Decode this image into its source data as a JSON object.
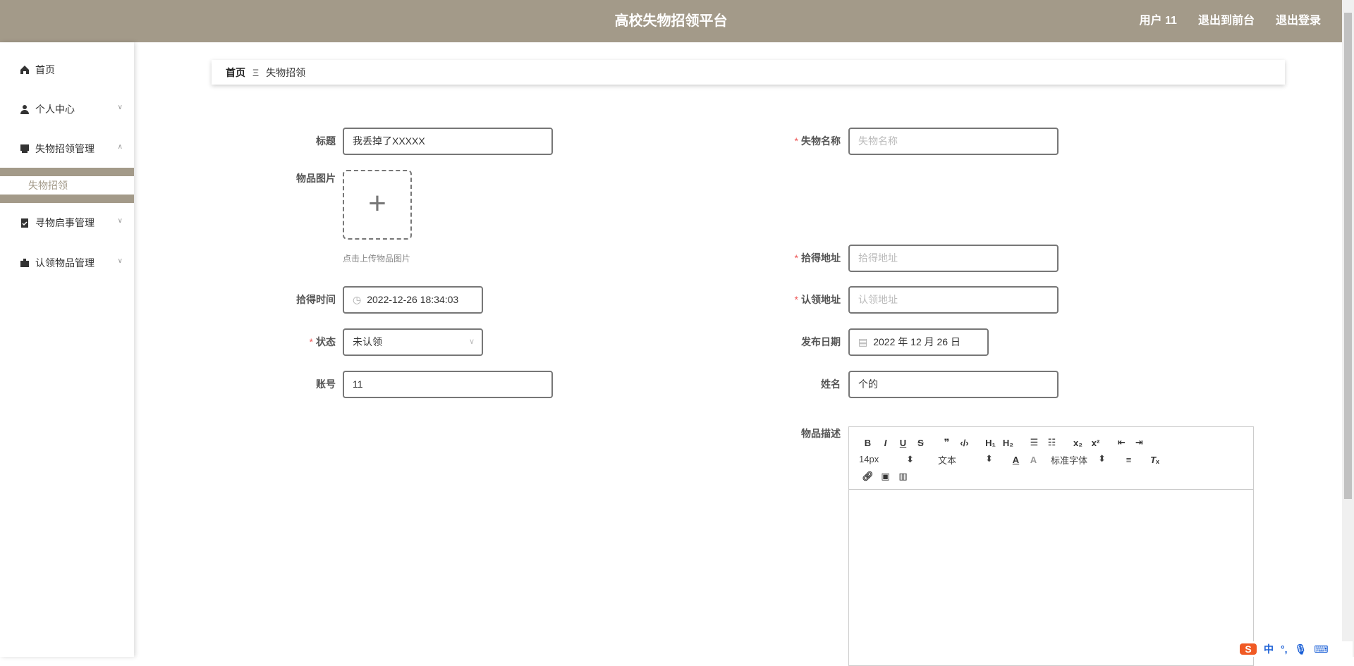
{
  "header": {
    "title": "高校失物招领平台",
    "user": "用户 11",
    "to_front": "退出到前台",
    "logout": "退出登录"
  },
  "sidebar": {
    "items": [
      {
        "label": "首页"
      },
      {
        "label": "个人中心"
      },
      {
        "label": "失物招领管理"
      },
      {
        "label": "寻物启事管理"
      },
      {
        "label": "认领物品管理"
      }
    ],
    "sub_active": "失物招领"
  },
  "breadcrumb": {
    "home": "首页",
    "sep": "Ξ",
    "current": "失物招领"
  },
  "form": {
    "title": {
      "label": "标题",
      "value": "我丢掉了XXXXX"
    },
    "name": {
      "label": "失物名称",
      "placeholder": "失物名称"
    },
    "image": {
      "label": "物品图片",
      "hint": "点击上传物品图片"
    },
    "found_addr": {
      "label": "拾得地址",
      "placeholder": "拾得地址"
    },
    "found_time": {
      "label": "拾得时间",
      "value": "2022-12-26 18:34:03"
    },
    "claim_addr": {
      "label": "认领地址",
      "placeholder": "认领地址"
    },
    "status": {
      "label": "状态",
      "value": "未认领"
    },
    "pub_date": {
      "label": "发布日期",
      "value": "2022 年 12 月 26 日"
    },
    "account": {
      "label": "账号",
      "value": "11"
    },
    "realname": {
      "label": "姓名",
      "value": "个的"
    },
    "desc": {
      "label": "物品描述"
    }
  },
  "editor": {
    "font_size": "14px",
    "block": "文本",
    "font": "标准字体"
  },
  "ime": {
    "lang": "中",
    "punct": "°,"
  }
}
